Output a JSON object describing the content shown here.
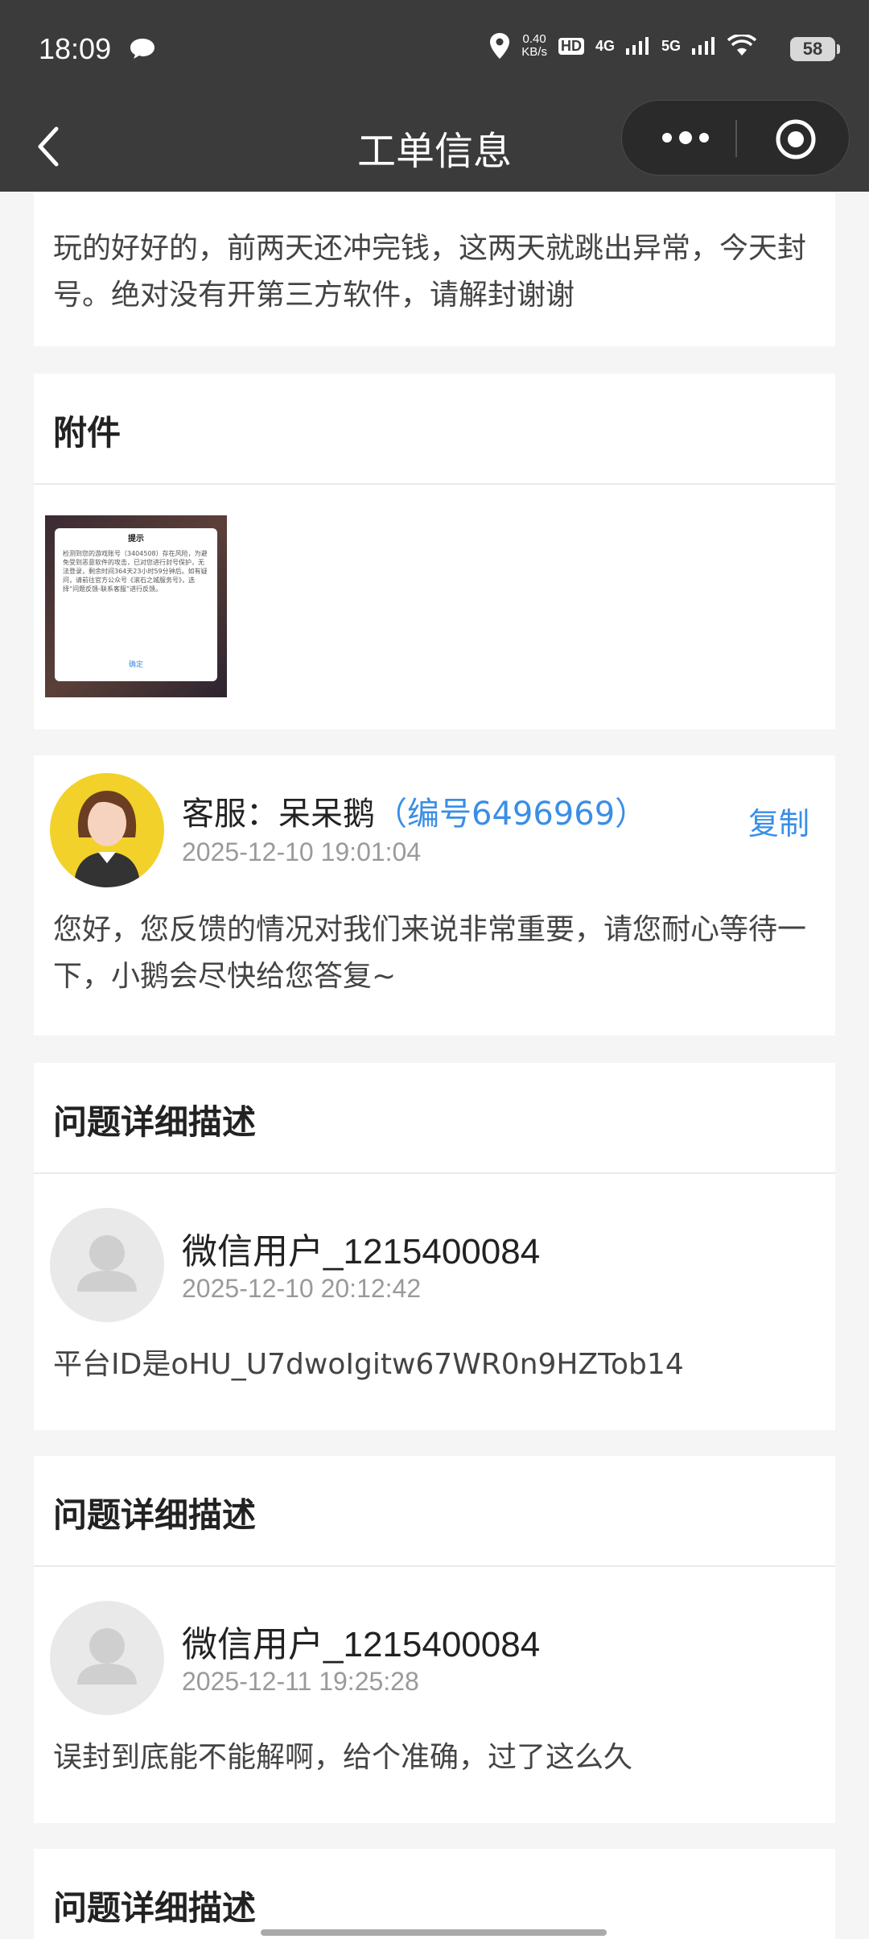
{
  "status_bar": {
    "time": "18:09",
    "net_speed_value": "0.40",
    "net_speed_unit": "KB/s",
    "hd_label": "HD",
    "signal_4g": "4G",
    "signal_5g": "5G",
    "battery": "58"
  },
  "nav": {
    "title": "工单信息"
  },
  "complaint_text": "玩的好好的，前两天还冲完钱，这两天就跳出异常，今天封号。绝对没有开第三方软件，请解封谢谢",
  "attachment": {
    "title": "附件",
    "thumb": {
      "heading": "提示",
      "body": "检测到您的游戏账号（3404508）存在风险，为避免受到恶意软件的攻击，已对您进行封号保护，无法登录，剩余时间364天23小时59分钟后。如有疑问，请前往官方公众号《滚石之城服务号》，选择“问题反馈-联系客服”进行反馈。",
      "confirm": "确定"
    }
  },
  "agent_reply": {
    "prefix": "客服：",
    "agent_name": "呆呆鹅",
    "agent_id": "（编号6496969）",
    "copy_label": "复制",
    "date": "2025-12-10 19:01:04",
    "message": "您好，您反馈的情况对我们来说非常重要，请您耐心等待一下，小鹅会尽快给您答复~"
  },
  "details": [
    {
      "title": "问题详细描述",
      "user": "微信用户_1215400084",
      "date": "2025-12-10 20:12:42",
      "message": "平台ID是oHU_U7dwoIgitw67WR0n9HZTob14"
    },
    {
      "title": "问题详细描述",
      "user": "微信用户_1215400084",
      "date": "2025-12-11 19:25:28",
      "message": "误封到底能不能解啊，给个准确，过了这么久"
    },
    {
      "title": "问题详细描述"
    }
  ],
  "colors": {
    "header_bg": "#3b3b3b",
    "page_bg": "#f5f5f5",
    "accent_blue": "#3a8ee6",
    "muted_text": "#9a9a9a"
  }
}
